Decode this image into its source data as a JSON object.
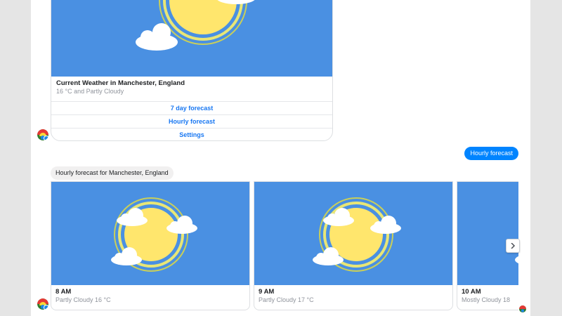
{
  "top_card": {
    "title": "Current Weather in Manchester, England",
    "subtitle": "16 °C and Partly Cloudy",
    "buttons": [
      {
        "label": "7 day forecast"
      },
      {
        "label": "Hourly forecast"
      },
      {
        "label": "Settings"
      }
    ]
  },
  "user_message": "Hourly forecast",
  "bot_message": "Hourly forecast for Manchester, England",
  "hourly_cards": [
    {
      "time": "8 AM",
      "summary": "Partly Cloudy 16 °C",
      "icon": "sun-cloud-icon"
    },
    {
      "time": "9 AM",
      "summary": "Partly Cloudy 17 °C",
      "icon": "sun-cloud-icon"
    },
    {
      "time": "10 AM",
      "summary": "Mostly Cloudy 18",
      "icon": "sun-cloud-icon"
    }
  ],
  "icons": {
    "next": "chevron-right-icon",
    "avatar": "weather-bot-avatar"
  },
  "colors": {
    "card_bg": "#4a90e2",
    "sun": "#ffe66d",
    "link": "#1877f2",
    "user_bubble": "#0084ff"
  }
}
